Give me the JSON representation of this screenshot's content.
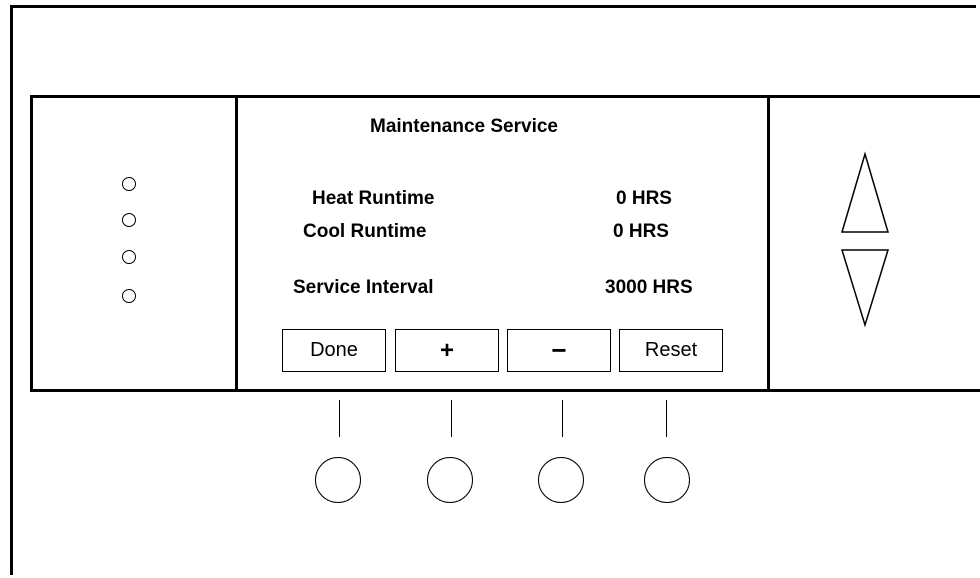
{
  "screen": {
    "title": "Maintenance Service",
    "rows": [
      {
        "label": "Heat Runtime",
        "value": "0 HRS"
      },
      {
        "label": "Cool Runtime",
        "value": "0 HRS"
      },
      {
        "label": "Service Interval",
        "value": "3000 HRS"
      }
    ]
  },
  "soft_buttons": [
    {
      "label": "Done"
    },
    {
      "label": "+"
    },
    {
      "label": "−"
    },
    {
      "label": "Reset"
    }
  ],
  "icons": {
    "leds": [
      "indicator-led-icon",
      "indicator-led-icon",
      "indicator-led-icon",
      "indicator-led-icon"
    ],
    "arrows": [
      "up-arrow-icon",
      "down-arrow-icon"
    ]
  }
}
